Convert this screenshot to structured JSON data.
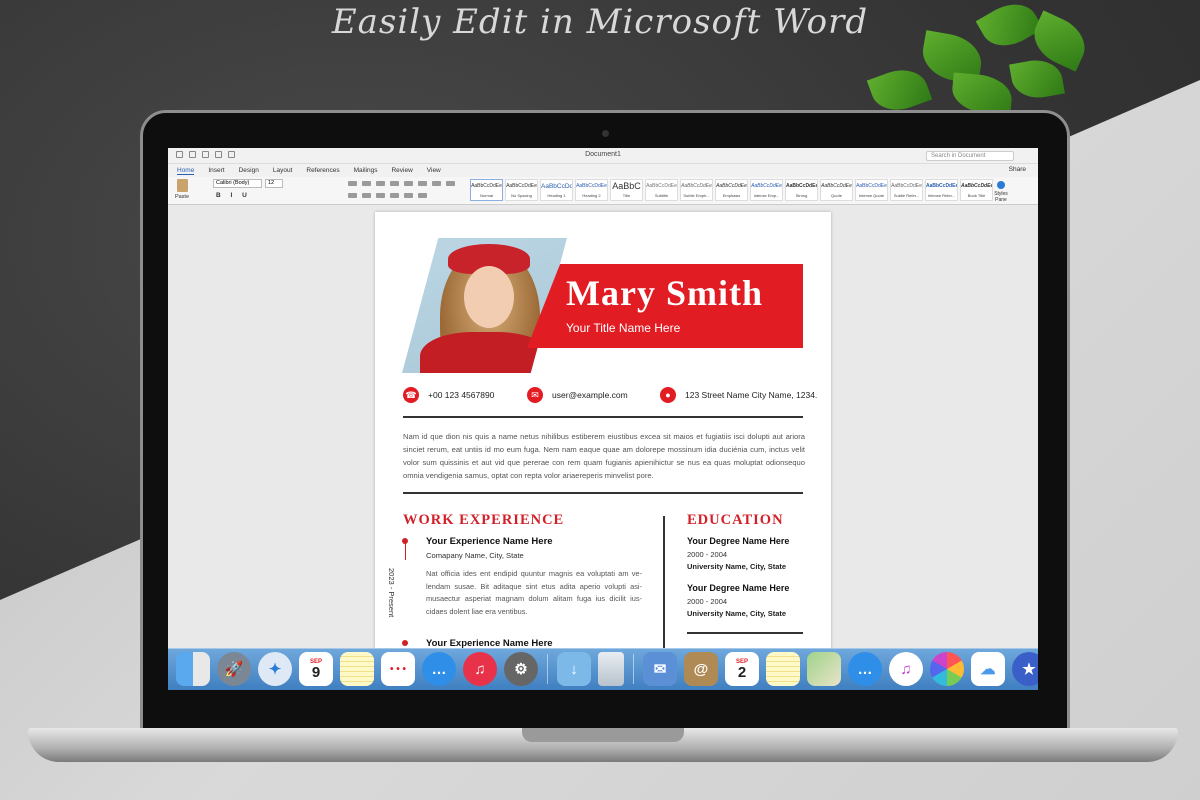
{
  "promo": {
    "headline": "Easily Edit in Microsoft Word"
  },
  "word": {
    "doc_title": "Document1",
    "search_placeholder": "Search in Document",
    "share_label": "Share",
    "tabs": [
      "Home",
      "Insert",
      "Design",
      "Layout",
      "References",
      "Mailings",
      "Review",
      "View"
    ],
    "active_tab": "Home",
    "paste_label": "Paste",
    "font_name": "Calibri (Body)",
    "font_size": "12",
    "format_buttons": "B I U",
    "styles": [
      {
        "sample": "AaBbCcDdEe",
        "name": "Normal"
      },
      {
        "sample": "AaBbCcDdEe",
        "name": "No Spacing"
      },
      {
        "sample": "AaBbCcDd",
        "name": "Heading 1"
      },
      {
        "sample": "AaBbCcDdEe",
        "name": "Heading 2"
      },
      {
        "sample": "AaBbC",
        "name": "Title"
      },
      {
        "sample": "AaBbCcDdEe",
        "name": "Subtitle"
      },
      {
        "sample": "AaBbCcDdEe",
        "name": "Subtle Emph..."
      },
      {
        "sample": "AaBbCcDdEe",
        "name": "Emphasis"
      },
      {
        "sample": "AaBbCcDdEe",
        "name": "Intense Emp..."
      },
      {
        "sample": "AaBbCcDdEe",
        "name": "Strong"
      },
      {
        "sample": "AaBbCcDdEe",
        "name": "Quote"
      },
      {
        "sample": "AaBbCcDdEe",
        "name": "Intense Quote"
      },
      {
        "sample": "AaBbCcDdEe",
        "name": "Subtle Refer..."
      },
      {
        "sample": "AaBbCcDdEe",
        "name": "Intense Refer..."
      },
      {
        "sample": "AaBbCcDdEe",
        "name": "Book Title"
      }
    ],
    "styles_pane_label": "Styles Pane"
  },
  "resume": {
    "name": "Mary Smith",
    "title": "Your Title Name Here",
    "phone": "+00 123 4567890",
    "email": "user@example.com",
    "address": "123 Street Name City Name, 1234.",
    "summary": "Nam id que dion nis quis a name netus nihilibus estiberem eiustibus excea sit maios et fugiatiis isci dolupti aut ariora sinciet rerum, eat untiis id mo eum fuga. Nem nam eaque quae am dolorepe mossinum idia duciénia cum, inctus velit volor sum quissinis et aut vid que pererae con rem quam fugianis apienihictur se nus ea quas moluptat odionsequo omnia vendigenia samus, optat con repta volor ariaereperis minvelist pore.",
    "work_heading": "WORK EXPERIENCE",
    "education_heading": "EDUCATION",
    "experience": [
      {
        "title": "Your Experience Name Here",
        "company": "Comapany Name, City, State",
        "date": "2023 - Present",
        "desc": "Nat officia ides ent endipid quuntur magnis ea voluptati am ve-lendam susae. Bit aditaque sint etus adita aperio volupti asi-musaectur asperiat magnam dolum alitam fuga ius dicilit ius-cidaes dolent liae era ventibus."
      },
      {
        "title": "Your Experience Name Here"
      }
    ],
    "education": [
      {
        "degree": "Your Degree Name Here",
        "years": "2000 - 2004",
        "school": "University Name, City, State"
      },
      {
        "degree": "Your Degree Name Here",
        "years": "2000 - 2004",
        "school": "University Name, City, State"
      }
    ]
  },
  "dock": {
    "calendar_month": "SEP",
    "calendar_day": "9",
    "calendar2_day": "2",
    "apps": [
      "Finder",
      "Launchpad",
      "Safari",
      "Calendar",
      "Notes",
      "Reminders",
      "Messages",
      "Music",
      "System Preferences",
      "Downloads",
      "Trash",
      "Mail",
      "Contacts",
      "Calendar",
      "Notes",
      "Maps",
      "Messages",
      "iTunes",
      "Photos",
      "iCloud",
      "iMovie"
    ]
  },
  "colors": {
    "accent": "#e21c23",
    "word_blue": "#2a5db0",
    "dock_blue": "#4f8fd0"
  }
}
